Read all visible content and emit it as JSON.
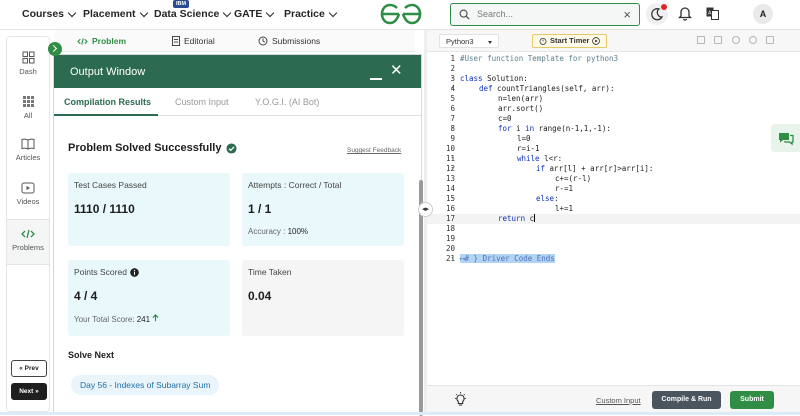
{
  "nav": {
    "items": [
      "Courses",
      "Placement",
      "Data Science",
      "GATE",
      "Practice"
    ],
    "ibm_badge": "IBM",
    "search_placeholder": "Search...",
    "search_clear": "×",
    "avatar_letter": "A"
  },
  "sidebar": {
    "items": [
      {
        "label": "Dash",
        "icon": "grid-icon"
      },
      {
        "label": "All",
        "icon": "apps-icon"
      },
      {
        "label": "Articles",
        "icon": "book-icon"
      },
      {
        "label": "Videos",
        "icon": "video-icon"
      },
      {
        "label": "Problems",
        "icon": "code-icon",
        "active": true
      }
    ],
    "prev_label": "« Prev",
    "next_label": "Next »"
  },
  "problem_tabs": [
    {
      "label": "Problem",
      "icon": "code-icon",
      "active": true
    },
    {
      "label": "Editorial",
      "icon": "document-icon"
    },
    {
      "label": "Submissions",
      "icon": "clock-icon"
    }
  ],
  "output_window": {
    "title": "Output Window",
    "tabs": [
      "Compilation Results",
      "Custom Input",
      "Y.O.G.I. (AI Bot)"
    ],
    "status": "Problem Solved Successfully",
    "suggest_feedback": "Suggest Feedback",
    "cards": {
      "test_cases": {
        "label": "Test Cases Passed",
        "value": "1110 / 1110"
      },
      "attempts": {
        "label": "Attempts : Correct / Total",
        "value": "1 / 1",
        "sub_label": "Accuracy :",
        "sub_value": "100%"
      },
      "points": {
        "label": "Points Scored",
        "value": "4 / 4",
        "sub_label": "Your Total Score:",
        "sub_value": "241"
      },
      "time": {
        "label": "Time Taken",
        "value": "0.04"
      }
    },
    "solve_next_heading": "Solve Next",
    "next_problem": "Day 56 - Indexes of Subarray Sum"
  },
  "editor": {
    "language": "Python3",
    "timer_label": "Start Timer",
    "lines": [
      {
        "n": "1",
        "text": "#User function Template for python3",
        "cls": "cm",
        "indent": 0
      },
      {
        "n": "2",
        "text": "",
        "indent": 0
      },
      {
        "n": "3",
        "text": "class Solution:",
        "indent": 0,
        "fold": true
      },
      {
        "n": "4",
        "text": "def countTriangles(self, arr):",
        "indent": 1,
        "fold": true
      },
      {
        "n": "5",
        "text": "n=len(arr)",
        "indent": 2
      },
      {
        "n": "6",
        "text": "arr.sort()",
        "indent": 2
      },
      {
        "n": "7",
        "text": "c=0",
        "indent": 2
      },
      {
        "n": "8",
        "text": "for i in range(n-1,1,-1):",
        "indent": 2,
        "fold": true
      },
      {
        "n": "9",
        "text": "l=0",
        "indent": 3
      },
      {
        "n": "10",
        "text": "r=i-1",
        "indent": 3
      },
      {
        "n": "11",
        "text": "while l<r:",
        "indent": 3,
        "fold": true
      },
      {
        "n": "12",
        "text": "if arr[l] + arr[r]>arr[i]:",
        "indent": 4,
        "fold": true
      },
      {
        "n": "13",
        "text": "c+=(r-l)",
        "indent": 5
      },
      {
        "n": "14",
        "text": "r-=1",
        "indent": 5
      },
      {
        "n": "15",
        "text": "else:",
        "indent": 4,
        "fold": true
      },
      {
        "n": "16",
        "text": "l+=1",
        "indent": 5
      },
      {
        "n": "17",
        "text": "return c",
        "indent": 2
      },
      {
        "n": "18",
        "text": "",
        "indent": 0
      },
      {
        "n": "19",
        "text": "",
        "indent": 0
      },
      {
        "n": "20",
        "text": "",
        "indent": 0
      },
      {
        "n": "21",
        "text": "# } Driver Code Ends",
        "indent": 0,
        "fold": true,
        "collapsed": "⟷"
      }
    ],
    "custom_input": "Custom Input",
    "compile_label": "Compile & Run",
    "submit_label": "Submit"
  },
  "colors": {
    "brand_green": "#2f8d46",
    "window_green": "#2c6b50",
    "card_bg": "#e9f8fb"
  }
}
